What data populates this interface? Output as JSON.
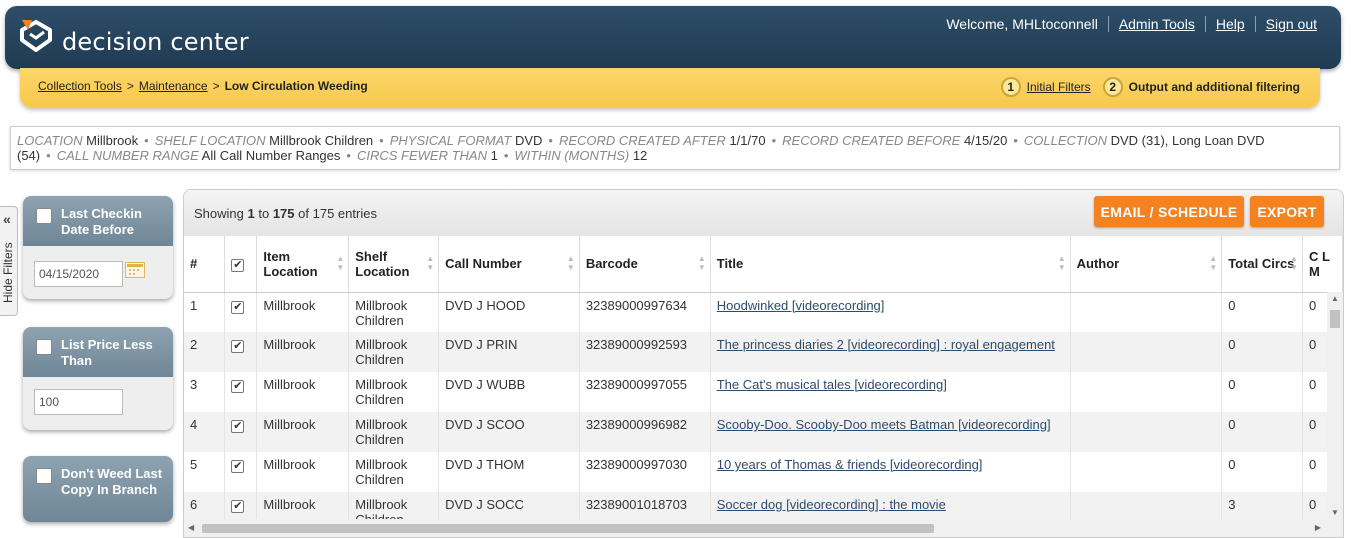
{
  "header": {
    "app_name": "decision center",
    "welcome": "Welcome, MHLtoconnell",
    "links": [
      "Admin Tools",
      "Help",
      "Sign out"
    ]
  },
  "breadcrumb": {
    "items": [
      "Collection Tools",
      "Maintenance"
    ],
    "current": "Low Circulation Weeding",
    "separator": ">"
  },
  "steps": [
    {
      "num": "1",
      "label": "Initial Filters"
    },
    {
      "num": "2",
      "label": "Output and additional filtering"
    }
  ],
  "summary": [
    {
      "key": "LOCATION",
      "value": "Millbrook"
    },
    {
      "key": "SHELF LOCATION",
      "value": "Millbrook Children"
    },
    {
      "key": "PHYSICAL FORMAT",
      "value": "DVD"
    },
    {
      "key": "RECORD CREATED AFTER",
      "value": "1/1/70"
    },
    {
      "key": "RECORD CREATED BEFORE",
      "value": "4/15/20"
    },
    {
      "key": "COLLECTION",
      "value": "DVD (31), Long Loan DVD (54)"
    },
    {
      "key": "CALL NUMBER RANGE",
      "value": "All Call Number Ranges"
    },
    {
      "key": "CIRCS FEWER THAN",
      "value": "1"
    },
    {
      "key": "WITHIN (MONTHS)",
      "value": "12"
    }
  ],
  "sidebar": {
    "hide_label": "Hide Filters",
    "collapse_glyph": "«",
    "filters": [
      {
        "label": "Last Checkin Date Before",
        "value": "04/15/2020"
      },
      {
        "label": "List Price Less Than",
        "value": "100"
      },
      {
        "label": "Don't Weed Last Copy In Branch"
      }
    ]
  },
  "table_info": {
    "prefix": "Showing",
    "from": "1",
    "to_word": "to",
    "to": "175",
    "of_word": "of",
    "total": "175 entries"
  },
  "actions": {
    "email": "EMAIL / SCHEDULE",
    "export": "EXPORT"
  },
  "columns": [
    "#",
    "",
    "Item Location",
    "Shelf Location",
    "Call Number",
    "Barcode",
    "Title",
    "Author",
    "Total Circs",
    "C L M"
  ],
  "rows": [
    {
      "n": "1",
      "loc": "Millbrook",
      "shelf": "Millbrook Children",
      "call": "DVD J HOOD",
      "barcode": "32389000997634",
      "title": "Hoodwinked [videorecording]",
      "author": "",
      "circs": "0",
      "last": "0"
    },
    {
      "n": "2",
      "loc": "Millbrook",
      "shelf": "Millbrook Children",
      "call": "DVD J PRIN",
      "barcode": "32389000992593",
      "title": "The princess diaries 2 [videorecording] : royal engagement",
      "author": "",
      "circs": "0",
      "last": "0"
    },
    {
      "n": "3",
      "loc": "Millbrook",
      "shelf": "Millbrook Children",
      "call": "DVD J WUBB",
      "barcode": "32389000997055",
      "title": "The Cat's musical tales [videorecording]",
      "author": "",
      "circs": "0",
      "last": "0"
    },
    {
      "n": "4",
      "loc": "Millbrook",
      "shelf": "Millbrook Children",
      "call": "DVD J SCOO",
      "barcode": "32389000996982",
      "title": "Scooby-Doo. Scooby-Doo meets Batman [videorecording]",
      "author": "",
      "circs": "0",
      "last": "0"
    },
    {
      "n": "5",
      "loc": "Millbrook",
      "shelf": "Millbrook Children",
      "call": "DVD J THOM",
      "barcode": "32389000997030",
      "title": "10 years of Thomas & friends [videorecording]",
      "author": "",
      "circs": "0",
      "last": "0"
    },
    {
      "n": "6",
      "loc": "Millbrook",
      "shelf": "Millbrook Children",
      "call": "DVD J SOCC",
      "barcode": "32389001018703",
      "title": "Soccer dog [videorecording] : the movie",
      "author": "",
      "circs": "3",
      "last": "0"
    }
  ],
  "colors": {
    "header_bg": "#2a4660",
    "crumb_bg": "#f9cf57",
    "accent_orange": "#f58220",
    "filter_head": "#7d93a3",
    "logo_orange": "#f58220"
  }
}
